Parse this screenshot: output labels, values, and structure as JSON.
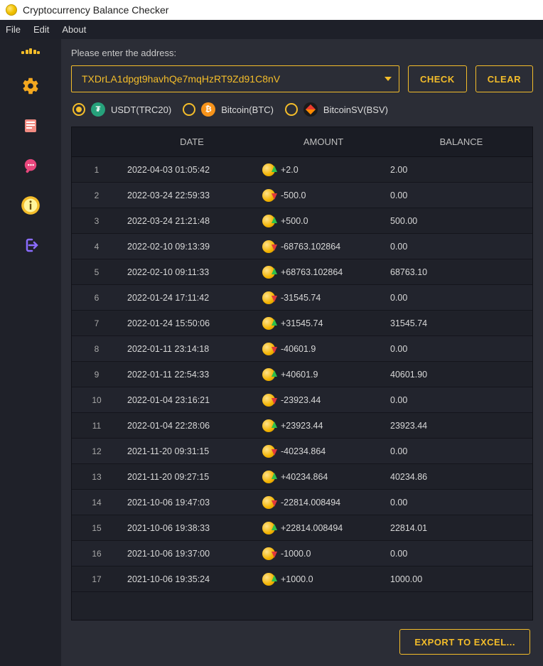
{
  "titlebar": {
    "title": "Cryptocurrency Balance Checker"
  },
  "menu": {
    "items": [
      "File",
      "Edit",
      "About"
    ]
  },
  "sidebar": {
    "icons": [
      "dots",
      "gear",
      "book",
      "chat",
      "info",
      "logout"
    ]
  },
  "content": {
    "prompt": "Please enter the address:",
    "address_value": "TXDrLA1dpgt9havhQe7mqHzRT9Zd91C8nV",
    "check_label": "CHECK",
    "clear_label": "CLEAR",
    "export_label": "EXPORT TO EXCEL..."
  },
  "coins": [
    {
      "label": "USDT(TRC20)",
      "icon": "usdt",
      "selected": true
    },
    {
      "label": "Bitcoin(BTC)",
      "icon": "btc",
      "selected": false
    },
    {
      "label": "BitcoinSV(BSV)",
      "icon": "bsv",
      "selected": false
    }
  ],
  "table": {
    "headers": {
      "date": "DATE",
      "amount": "AMOUNT",
      "balance": "BALANCE"
    },
    "rows": [
      {
        "idx": 1,
        "date": "2022-04-03 01:05:42",
        "amount": "+2.0",
        "dir": "up",
        "balance": "2.00"
      },
      {
        "idx": 2,
        "date": "2022-03-24 22:59:33",
        "amount": "-500.0",
        "dir": "down",
        "balance": "0.00"
      },
      {
        "idx": 3,
        "date": "2022-03-24 21:21:48",
        "amount": "+500.0",
        "dir": "up",
        "balance": "500.00"
      },
      {
        "idx": 4,
        "date": "2022-02-10 09:13:39",
        "amount": "-68763.102864",
        "dir": "down",
        "balance": "0.00"
      },
      {
        "idx": 5,
        "date": "2022-02-10 09:11:33",
        "amount": "+68763.102864",
        "dir": "up",
        "balance": "68763.10"
      },
      {
        "idx": 6,
        "date": "2022-01-24 17:11:42",
        "amount": "-31545.74",
        "dir": "down",
        "balance": "0.00"
      },
      {
        "idx": 7,
        "date": "2022-01-24 15:50:06",
        "amount": "+31545.74",
        "dir": "up",
        "balance": "31545.74"
      },
      {
        "idx": 8,
        "date": "2022-01-11 23:14:18",
        "amount": "-40601.9",
        "dir": "down",
        "balance": "0.00"
      },
      {
        "idx": 9,
        "date": "2022-01-11 22:54:33",
        "amount": "+40601.9",
        "dir": "up",
        "balance": "40601.90"
      },
      {
        "idx": 10,
        "date": "2022-01-04 23:16:21",
        "amount": "-23923.44",
        "dir": "down",
        "balance": "0.00"
      },
      {
        "idx": 11,
        "date": "2022-01-04 22:28:06",
        "amount": "+23923.44",
        "dir": "up",
        "balance": "23923.44"
      },
      {
        "idx": 12,
        "date": "2021-11-20 09:31:15",
        "amount": "-40234.864",
        "dir": "down",
        "balance": "0.00"
      },
      {
        "idx": 13,
        "date": "2021-11-20 09:27:15",
        "amount": "+40234.864",
        "dir": "up",
        "balance": "40234.86"
      },
      {
        "idx": 14,
        "date": "2021-10-06 19:47:03",
        "amount": "-22814.008494",
        "dir": "down",
        "balance": "0.00"
      },
      {
        "idx": 15,
        "date": "2021-10-06 19:38:33",
        "amount": "+22814.008494",
        "dir": "up",
        "balance": "22814.01"
      },
      {
        "idx": 16,
        "date": "2021-10-06 19:37:00",
        "amount": "-1000.0",
        "dir": "down",
        "balance": "0.00"
      },
      {
        "idx": 17,
        "date": "2021-10-06 19:35:24",
        "amount": "+1000.0",
        "dir": "up",
        "balance": "1000.00"
      }
    ]
  }
}
